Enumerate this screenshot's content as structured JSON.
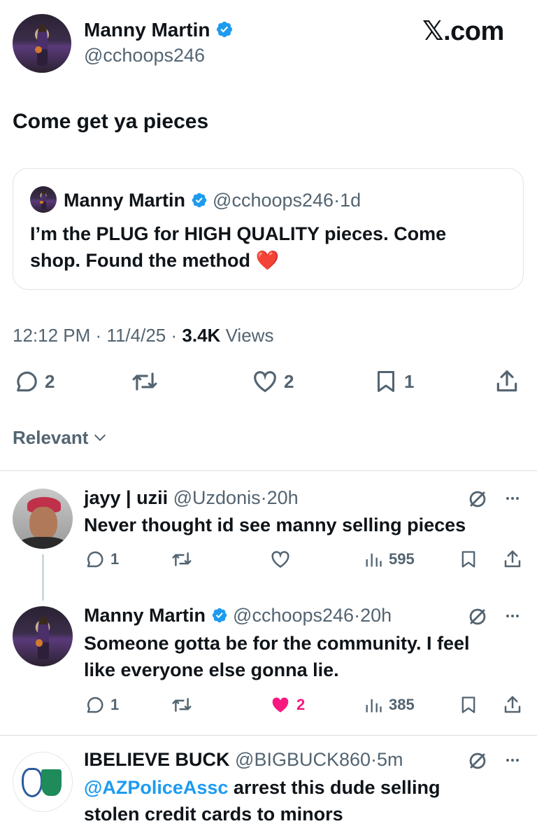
{
  "brand": {
    "logo_text": "𝕏.com"
  },
  "tweet": {
    "author_name": "Manny Martin",
    "author_handle": "@cchoops246",
    "text": "Come get ya pieces",
    "quote": {
      "author_name": "Manny Martin",
      "author_handle": "@cchoops246",
      "separator": "·",
      "time": "1d",
      "text_line1": "I’m the PLUG for HIGH QUALITY pieces. Come",
      "text_line2": "shop. Found the method",
      "emoji": "❤️"
    },
    "meta": {
      "time": "12:12 PM",
      "dot1": "·",
      "date": "11/4/25",
      "dot2": "·",
      "views_count": "3.4K",
      "views_label": "Views"
    },
    "actions": {
      "replies": "2",
      "likes": "2",
      "bookmarks": "1"
    }
  },
  "sort": {
    "label": "Relevant",
    "icon": "chevron-down-icon"
  },
  "replies": [
    {
      "name": "jayy | uzii",
      "handle": "@Uzdonis",
      "separator": "·",
      "time": "20h",
      "text": "Never thought id see manny selling pieces",
      "replies": "1",
      "likes": "",
      "views": "595"
    },
    {
      "name": "Manny Martin",
      "handle": "@cchoops246",
      "separator": "·",
      "time": "20h",
      "text_line1": "Someone gotta be for the community. I feel",
      "text_line2": "like everyone else gonna lie.",
      "replies": "1",
      "likes": "2",
      "views": "385"
    },
    {
      "name": "IBELIEVE BUCK",
      "handle": "@BIGBUCK860",
      "separator": "·",
      "time": "5m",
      "mention": "@AZPoliceAssc",
      "text_line1": "arrest this dude selling",
      "text_line2": "stolen credit cards to minors"
    }
  ],
  "colors": {
    "accent": "#1d9bf0",
    "like": "#f91880",
    "text": "#0f1419",
    "muted": "#536471"
  },
  "icons": [
    "verified-badge-icon",
    "reply-icon",
    "retweet-icon",
    "like-icon",
    "bookmark-icon",
    "share-icon",
    "views-icon",
    "grok-icon",
    "more-icon",
    "chevron-down-icon"
  ]
}
